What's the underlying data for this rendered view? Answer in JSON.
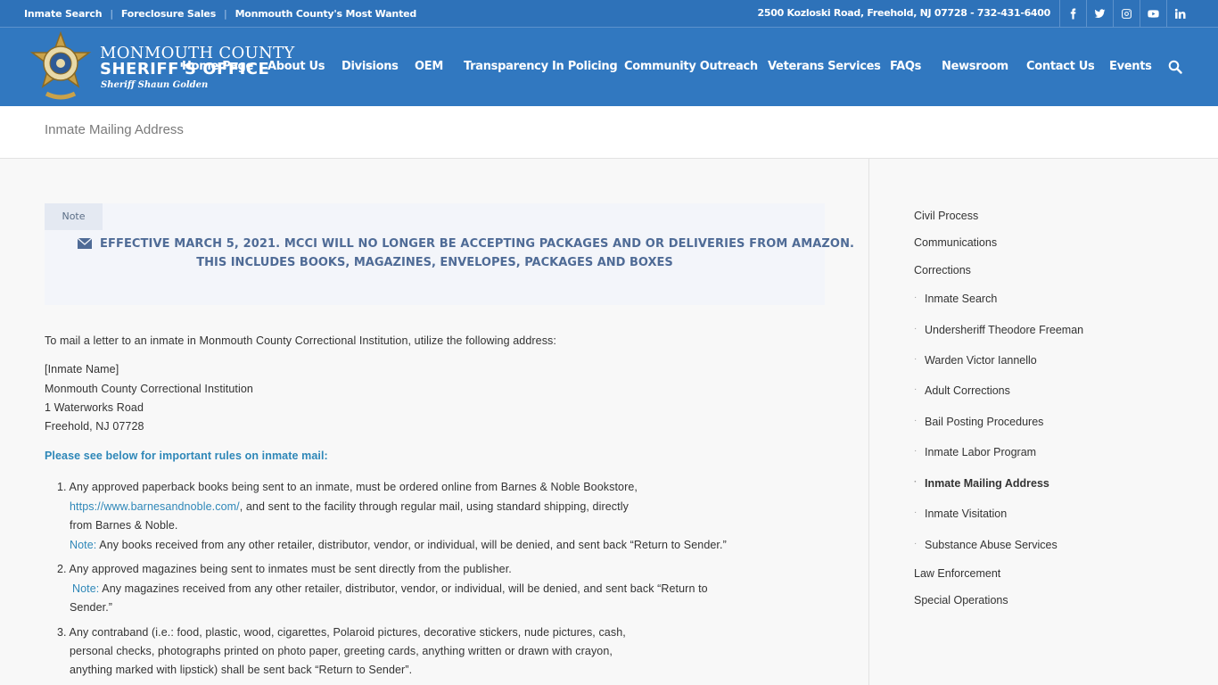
{
  "topbar": {
    "links": [
      "Inmate Search",
      "Foreclosure Sales",
      "Monmouth County's Most Wanted"
    ],
    "address": "2500 Kozloski Road, Freehold, NJ 07728 - 732-431-6400",
    "socials": [
      "facebook-icon",
      "twitter-icon",
      "instagram-icon",
      "youtube-icon",
      "linkedin-icon"
    ]
  },
  "logo": {
    "line1": "MONMOUTH COUNTY",
    "line2": "SHERIFF'S OFFICE",
    "line3": "Sheriff Shaun Golden"
  },
  "nav": {
    "items": [
      "Home Page",
      "About Us",
      "Divisions",
      "OEM",
      "Transparency In Policing",
      "Community Outreach",
      "Veterans Services",
      "FAQs",
      "Newsroom",
      "Contact Us",
      "Events"
    ]
  },
  "page": {
    "title": "Inmate Mailing Address"
  },
  "note": {
    "tab": "Note",
    "line1": "EFFECTIVE MARCH 5, 2021. MCCI WILL NO LONGER BE ACCEPTING PACKAGES AND OR DELIVERIES FROM AMAZON.",
    "line2": "THIS INCLUDES BOOKS, MAGAZINES, ENVELOPES, PACKAGES AND BOXES"
  },
  "body": {
    "intro": "To mail a letter to an inmate in Monmouth County Correctional Institution, utilize the following address:",
    "address": [
      "[Inmate Name]",
      "Monmouth County Correctional Institution",
      "1 Waterworks Road",
      "Freehold, NJ 07728"
    ],
    "rules_heading": "Please see below for important rules on inmate mail:",
    "rule1_l1": "1.  Any approved paperback books being sent to an inmate, must be ordered online from Barnes & Noble  Bookstore,",
    "rule1_link": "https://www.barnesandnoble.com/",
    "rule1_l2": ", and sent to the facility through regular mail, using standard shipping, directly",
    "rule1_l3": "from Barnes & Noble.",
    "rule1_note_label": "Note:",
    "rule1_note": " Any books received from any other retailer, distributor, vendor, or individual, will be denied, and sent back  “Return to Sender.”",
    "rule2_l1": "2.  Any approved magazines being sent to inmates must be sent directly from the publisher.",
    "rule2_note_label": "Note:",
    "rule2_note": " Any magazines received from any other retailer, distributor, vendor, or individual, will be denied, and sent      back “Return to",
    "rule2_l3": "Sender.”",
    "rule3_l1": "3.  Any contraband (i.e.: food, plastic, wood, cigarettes, Polaroid pictures, decorative stickers, nude pictures, cash,",
    "rule3_l2": "personal checks, photographs printed on photo paper, greeting cards, anything written or drawn with crayon,",
    "rule3_l3": "anything marked with lipstick) shall be sent back “Return to Sender”."
  },
  "sidebar": {
    "top": [
      "Civil Process",
      "Communications",
      "Corrections"
    ],
    "sub": [
      "Inmate Search",
      "Undersheriff Theodore Freeman",
      "Warden Victor Iannello",
      "Adult Corrections",
      "Bail Posting Procedures",
      "Inmate Labor Program",
      "Inmate Mailing Address",
      "Inmate Visitation",
      "Substance Abuse Services"
    ],
    "bottom": [
      "Law Enforcement",
      "Special Operations"
    ],
    "active": "Inmate Mailing Address"
  },
  "colors": {
    "topbar": "#2e72b9",
    "header": "#3178c0",
    "link": "#2e87b8",
    "note_text": "#4f6b96"
  }
}
